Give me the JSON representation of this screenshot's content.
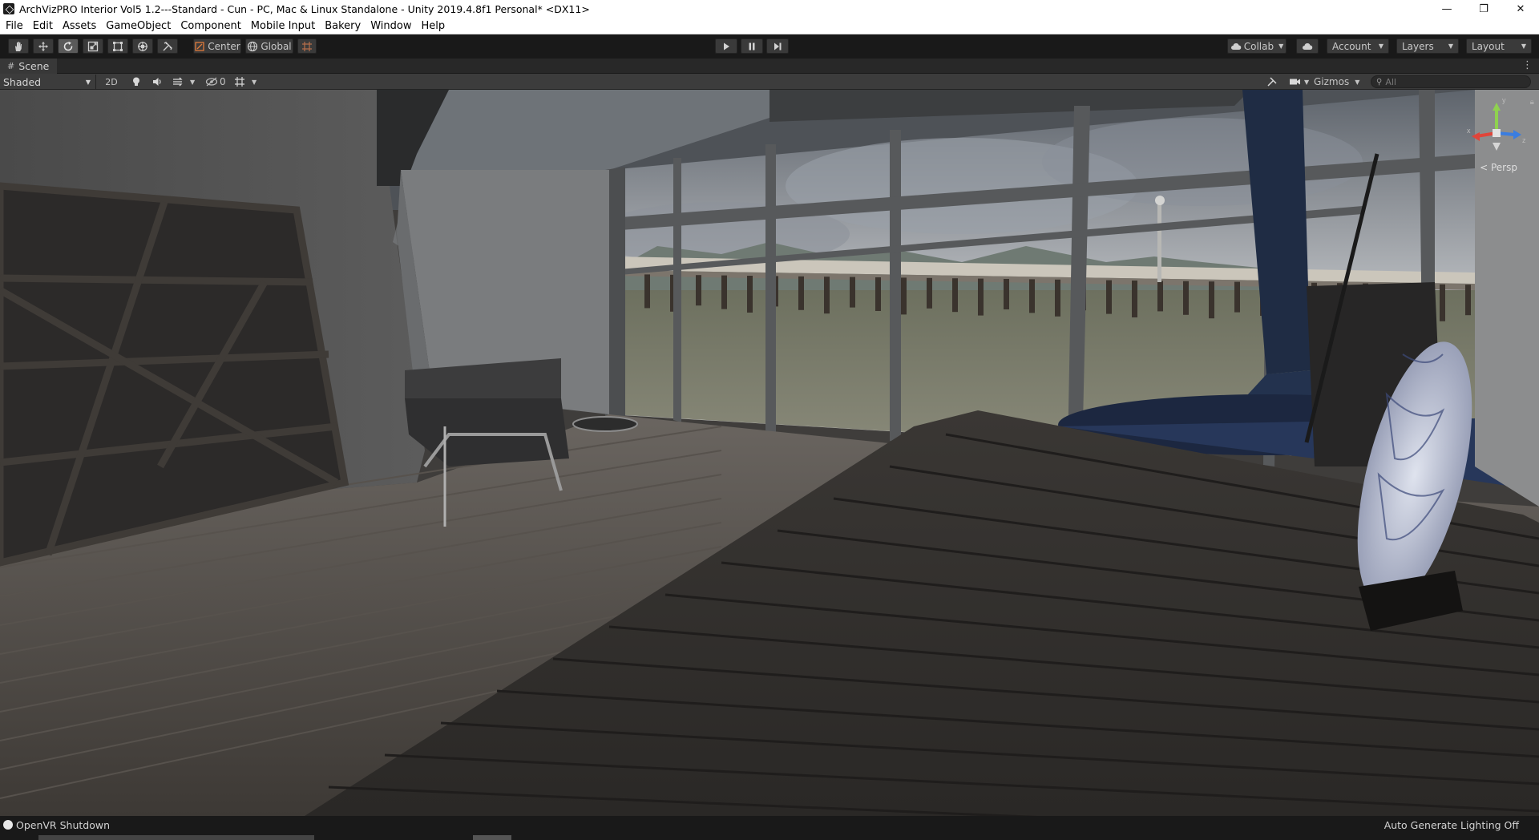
{
  "window": {
    "title": "ArchVizPRO Interior Vol5 1.2---Standard - Cun - PC, Mac & Linux Standalone - Unity 2019.4.8f1 Personal* <DX11>",
    "minimize_glyph": "—",
    "restore_glyph": "❐",
    "close_glyph": "✕"
  },
  "menu": [
    "File",
    "Edit",
    "Assets",
    "GameObject",
    "Component",
    "Mobile Input",
    "Bakery",
    "Window",
    "Help"
  ],
  "toolbar": {
    "pivot_label": "Center",
    "space_label": "Global",
    "collab_label": "Collab",
    "account_label": "Account",
    "layers_label": "Layers",
    "layout_label": "Layout",
    "tools": [
      "hand-icon",
      "move-icon",
      "rotate-icon",
      "scale-icon",
      "rect-icon",
      "transform-icon",
      "custom-tool-icon"
    ],
    "active_tool": "rotate-icon"
  },
  "scene_tab": {
    "label": "Scene"
  },
  "scene_toolbar": {
    "draw_mode": "Shaded",
    "mode_2d": "2D",
    "hidden_count": "0",
    "gizmos_label": "Gizmos",
    "search_placeholder": "All"
  },
  "viewport": {
    "projection_label": "< Persp",
    "axis_labels": {
      "y": "y",
      "x": "x",
      "z": "z"
    }
  },
  "status": {
    "left": "OpenVR Shutdown",
    "right": "Auto Generate Lighting Off"
  },
  "colors": {
    "editor_dark": "#191919",
    "toolbar_button": "#3a3a3a",
    "scene_bar": "#3c3c3c",
    "axis_y": "#8fd14f",
    "axis_x": "#e0453a",
    "axis_z": "#3a7de0"
  }
}
